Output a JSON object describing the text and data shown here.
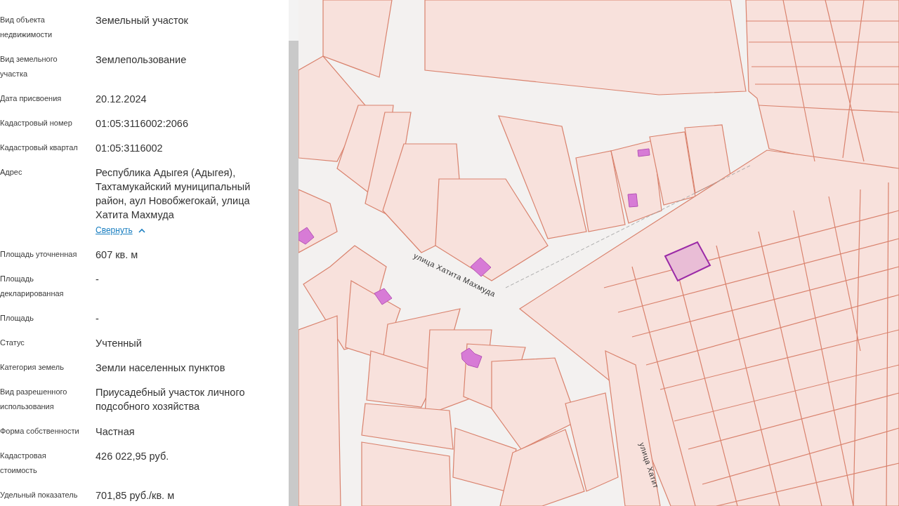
{
  "details": {
    "rows": [
      {
        "label": "Вид объекта недвижимости",
        "value": "Земельный участок"
      },
      {
        "label": "Вид земельного участка",
        "value": "Землепользование"
      },
      {
        "label": "Дата присвоения",
        "value": "20.12.2024"
      },
      {
        "label": "Кадастровый номер",
        "value": "01:05:3116002:2066"
      },
      {
        "label": "Кадастровый квартал",
        "value": "01:05:3116002"
      },
      {
        "label": "Адрес",
        "value": "Республика Адыгея (Адыгея), Тахтамукайский муниципальный район, аул Новобжегокай, улица Хатита Махмуда",
        "collapse_link": "Свернуть"
      },
      {
        "label": "Площадь уточненная",
        "value": "607 кв. м"
      },
      {
        "label": "Площадь декларированная",
        "value": "-"
      },
      {
        "label": "Площадь",
        "value": "-"
      },
      {
        "label": "Статус",
        "value": "Учтенный"
      },
      {
        "label": "Категория земель",
        "value": "Земли населенных пунктов"
      },
      {
        "label": "Вид разрешенного использования",
        "value": "Приусадебный участок личного подсобного хозяйства"
      },
      {
        "label": "Форма собственности",
        "value": "Частная"
      },
      {
        "label": "Кадастровая стоимость",
        "value": "426 022,95 руб."
      },
      {
        "label": "Удельный показатель",
        "value": "701,85 руб./кв. м"
      }
    ]
  },
  "map": {
    "street_labels": [
      "улица Хатита Махмуда",
      "улица Хатит"
    ]
  }
}
